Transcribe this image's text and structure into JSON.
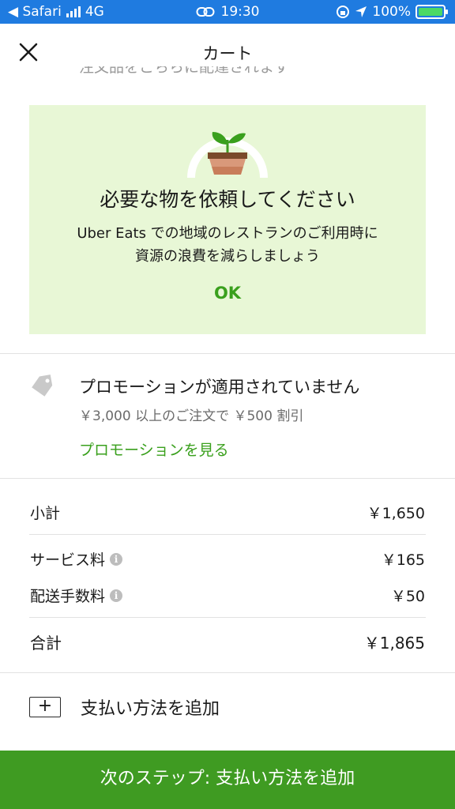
{
  "status_bar": {
    "carrier": "◀ Safari",
    "network": "4G",
    "time": "19:30",
    "battery": "100%",
    "color": "#1f7be0"
  },
  "header": {
    "title": "カート",
    "close_icon": "close-icon"
  },
  "clipped_text": "注文品をこちらに配達されます",
  "eco_card": {
    "title": "必要な物を依頼してください",
    "body_line1": "Uber Eats での地域のレストランのご利用時に",
    "body_line2": "資源の浪費を減らしましょう",
    "ok_label": "OK",
    "bg_color": "#e8f7d6",
    "accent": "#3aa01d"
  },
  "promotion": {
    "title": "プロモーションが適用されていません",
    "description": "￥3,000 以上のご注文で ￥500 割引",
    "link": "プロモーションを見る",
    "icon": "tag-icon"
  },
  "summary": {
    "subtotal": {
      "label": "小計",
      "value": "￥1,650"
    },
    "service_fee": {
      "label": "サービス料",
      "value": "￥165"
    },
    "delivery_fee": {
      "label": "配送手数料",
      "value": "￥50"
    },
    "total": {
      "label": "合計",
      "value": "￥1,865"
    }
  },
  "payment": {
    "plus": "+",
    "label": "支払い方法を追加"
  },
  "cta": {
    "label": "次のステップ: 支払い方法を追加",
    "color": "#3f9b22"
  }
}
